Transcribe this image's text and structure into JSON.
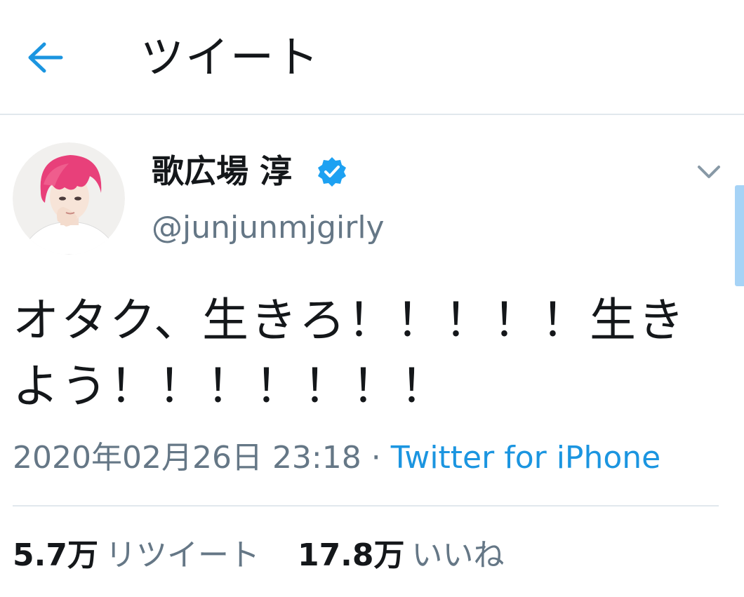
{
  "header": {
    "title": "ツイート",
    "back_icon": "arrow-left-icon"
  },
  "colors": {
    "accent": "#1b95e0",
    "text": "#14171a",
    "muted": "#657786",
    "divider": "#e1e8ed",
    "avatar_hair": "#e8407a"
  },
  "tweet": {
    "author_name": "歌広場 淳",
    "author_handle": "@junjunmjgirly",
    "verified_icon": "verified-badge-icon",
    "menu_icon": "chevron-down-icon",
    "text": "オタク、生きろ！！！！！生きよう！！！！！！！",
    "timestamp": "2020年02月26日 23:18",
    "separator": "·",
    "source": "Twitter for iPhone"
  },
  "stats": {
    "retweets_count": "5.7万",
    "retweets_label": "リツイート",
    "likes_count": "17.8万",
    "likes_label": "いいね"
  }
}
